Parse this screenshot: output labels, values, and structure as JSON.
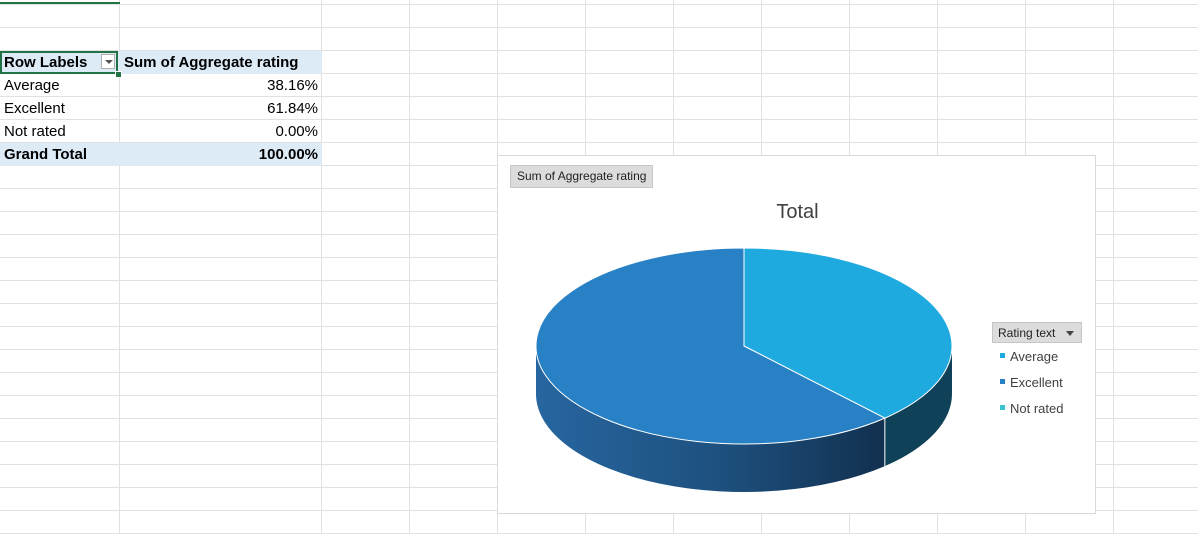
{
  "pivot": {
    "header": {
      "row_labels": "Row Labels",
      "value_header": "Sum of Aggregate rating"
    },
    "rows": [
      {
        "label": "Average",
        "value": "38.16%"
      },
      {
        "label": "Excellent",
        "value": "61.84%"
      },
      {
        "label": "Not rated",
        "value": "0.00%"
      }
    ],
    "total": {
      "label": "Grand Total",
      "value": "100.00%"
    }
  },
  "chart": {
    "field_button": "Sum of Aggregate rating",
    "legend_button": "Rating text",
    "colors": {
      "Average": "#1ea9df",
      "Excellent": "#2881c5",
      "Not rated": "#3cc3cf"
    }
  },
  "chart_data": {
    "type": "pie",
    "title": "Total",
    "categories": [
      "Average",
      "Excellent",
      "Not rated"
    ],
    "values": [
      38.16,
      61.84,
      0.0
    ],
    "legend": "right"
  }
}
